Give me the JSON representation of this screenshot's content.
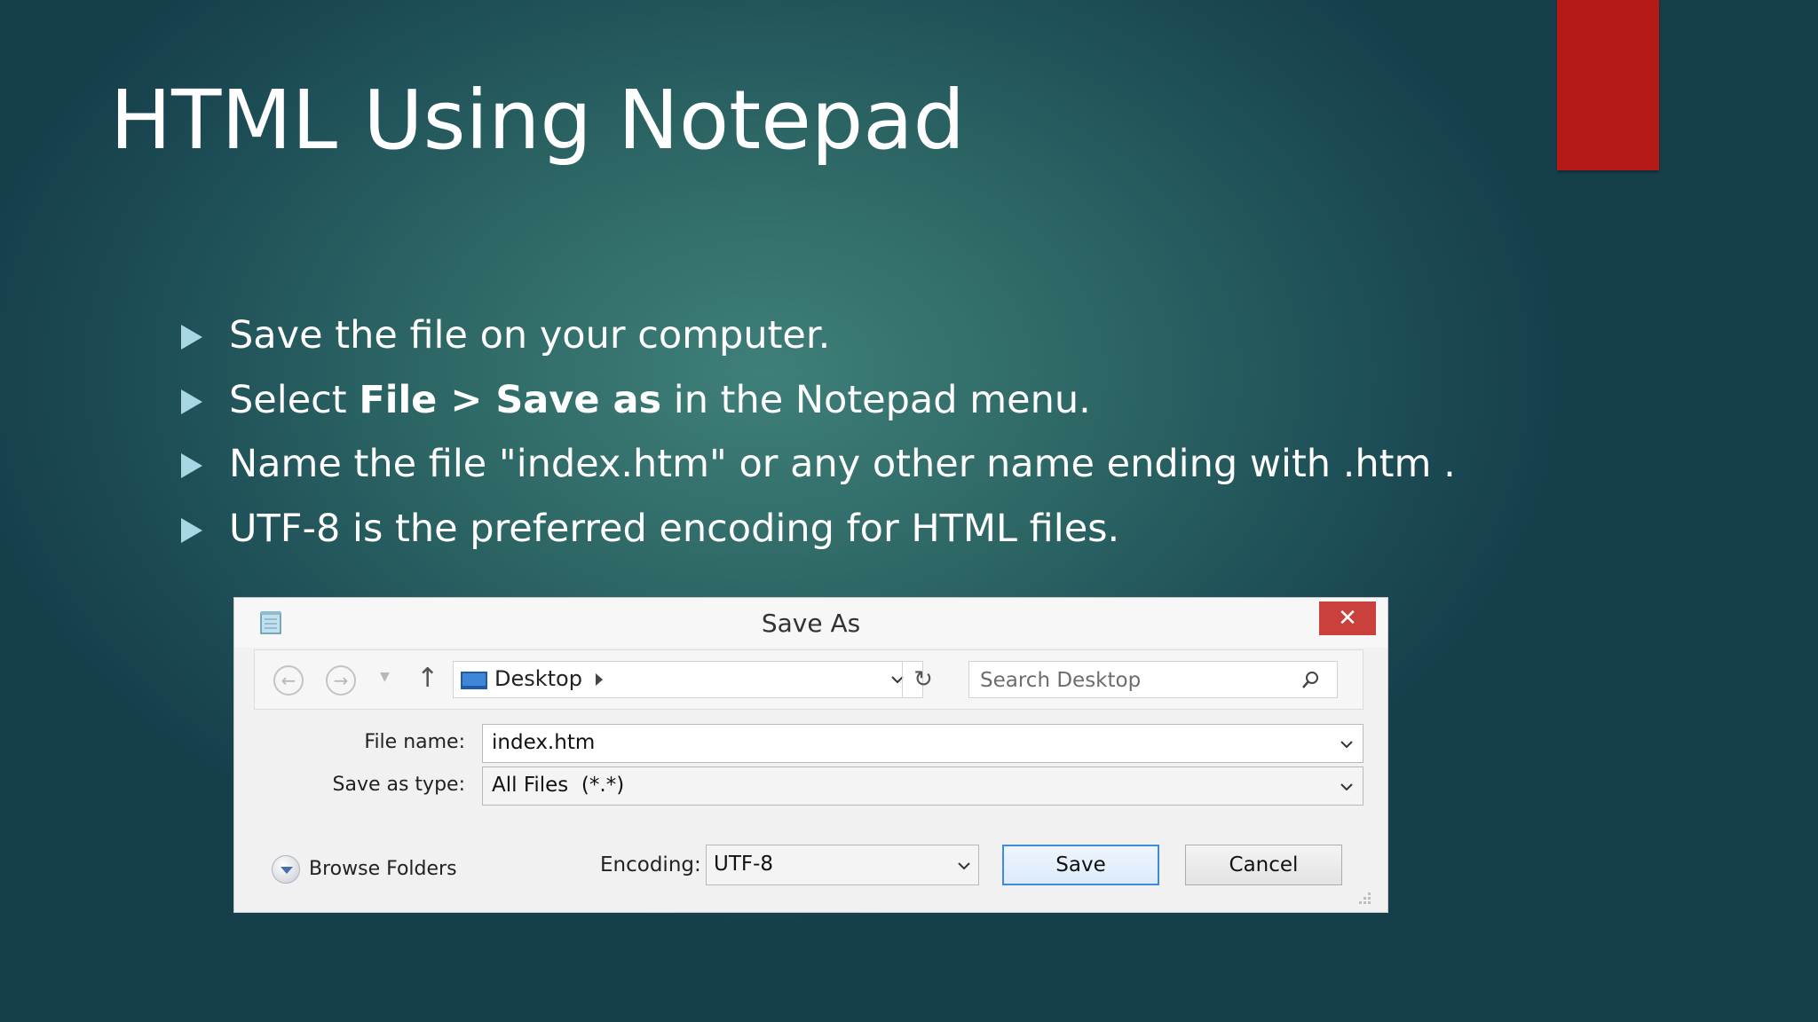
{
  "slide": {
    "title": "HTML Using Notepad",
    "bullets": [
      {
        "pre": "Save the file on your computer.",
        "bold": "",
        "post": ""
      },
      {
        "pre": "Select ",
        "bold": "File > Save as",
        "post": " in the Notepad menu."
      },
      {
        "pre": "Name the file \"index.htm\" or any other name ending with .htm .",
        "bold": "",
        "post": ""
      },
      {
        "pre": "UTF-8 is the preferred encoding for HTML files.",
        "bold": "",
        "post": ""
      }
    ]
  },
  "dialog": {
    "title": "Save As",
    "close_symbol": "✕",
    "address": "Desktop",
    "search_placeholder": "Search Desktop",
    "file_name": {
      "label": "File name:",
      "value": "index.htm"
    },
    "save_as_type": {
      "label": "Save as type:",
      "value": "All Files  (*.*)"
    },
    "browse_folders": "Browse Folders",
    "encoding": {
      "label": "Encoding:",
      "value": "UTF-8"
    },
    "save_label": "Save",
    "cancel_label": "Cancel"
  },
  "colors": {
    "accent_red": "#b51a17",
    "bullet_arrow": "#a9d6e3",
    "close_button": "#c9403c",
    "save_button_border": "#3c8be0"
  },
  "icons": [
    "notepad-icon",
    "back-arrow-icon",
    "forward-arrow-icon",
    "chevron-down-icon",
    "up-arrow-icon",
    "desktop-icon",
    "refresh-icon",
    "search-icon",
    "expand-circle-icon",
    "resize-grip-icon"
  ]
}
